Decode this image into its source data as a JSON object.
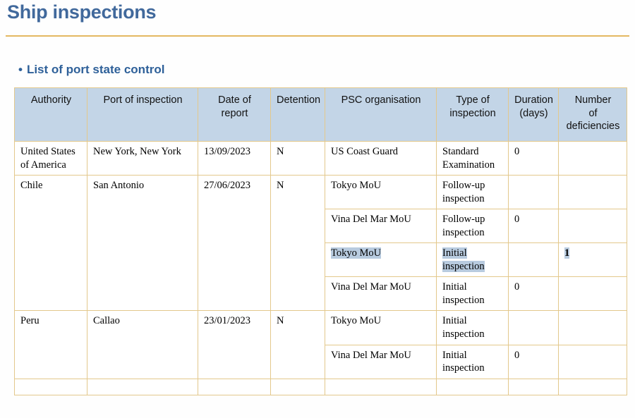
{
  "slide": {
    "title": "Ship inspections",
    "bullet_marker": "•",
    "bullet_text": "List of port state control",
    "accent_rule_color": "#e4b862",
    "title_color": "#41699c",
    "header_fill": "#c3d5e7",
    "border_color": "#e3c88c",
    "selection_color": "#b8cbdf"
  },
  "table": {
    "columns": [
      "Authority",
      "Port of inspection",
      "Date of report",
      "Detention",
      "PSC organisation",
      "Type of inspection",
      "Duration (days)",
      "Number of deficiencies"
    ],
    "columns_wrapped": [
      [
        "Authority"
      ],
      [
        "Port of inspection"
      ],
      [
        "Date of",
        "report"
      ],
      [
        "Detention"
      ],
      [
        "PSC organisation"
      ],
      [
        "Type of",
        "inspection"
      ],
      [
        "Duration",
        "(days)"
      ],
      [
        "Number",
        "of",
        "deficiencies"
      ]
    ],
    "groups": [
      {
        "authority": "United States of America",
        "port": "New York, New York",
        "date": "13/09/2023",
        "detention": "N",
        "inspections": [
          {
            "psc": "US Coast Guard",
            "type": "Standard Examination",
            "duration": "0",
            "deficiencies": "",
            "selected": false
          }
        ]
      },
      {
        "authority": "Chile",
        "port": "San Antonio",
        "date": "27/06/2023",
        "detention": "N",
        "inspections": [
          {
            "psc": "Tokyo MoU",
            "type": "Follow-up inspection",
            "duration": "",
            "deficiencies": "",
            "selected": false
          },
          {
            "psc": "Vina Del Mar MoU",
            "type": "Follow-up inspection",
            "duration": "0",
            "deficiencies": "",
            "selected": false
          },
          {
            "psc": "Tokyo MoU",
            "type": "Initial inspection",
            "duration": "",
            "deficiencies": "1",
            "selected": true
          },
          {
            "psc": "Vina Del Mar MoU",
            "type": "Initial inspection",
            "duration": "0",
            "deficiencies": "",
            "selected": false
          }
        ]
      },
      {
        "authority": "Peru",
        "port": "Callao",
        "date": "23/01/2023",
        "detention": "N",
        "inspections": [
          {
            "psc": "Tokyo MoU",
            "type": "Initial inspection",
            "duration": "",
            "deficiencies": "",
            "selected": false
          },
          {
            "psc": "Vina Del Mar MoU",
            "type": "Initial inspection",
            "duration": "0",
            "deficiencies": "",
            "selected": false
          }
        ]
      }
    ]
  }
}
